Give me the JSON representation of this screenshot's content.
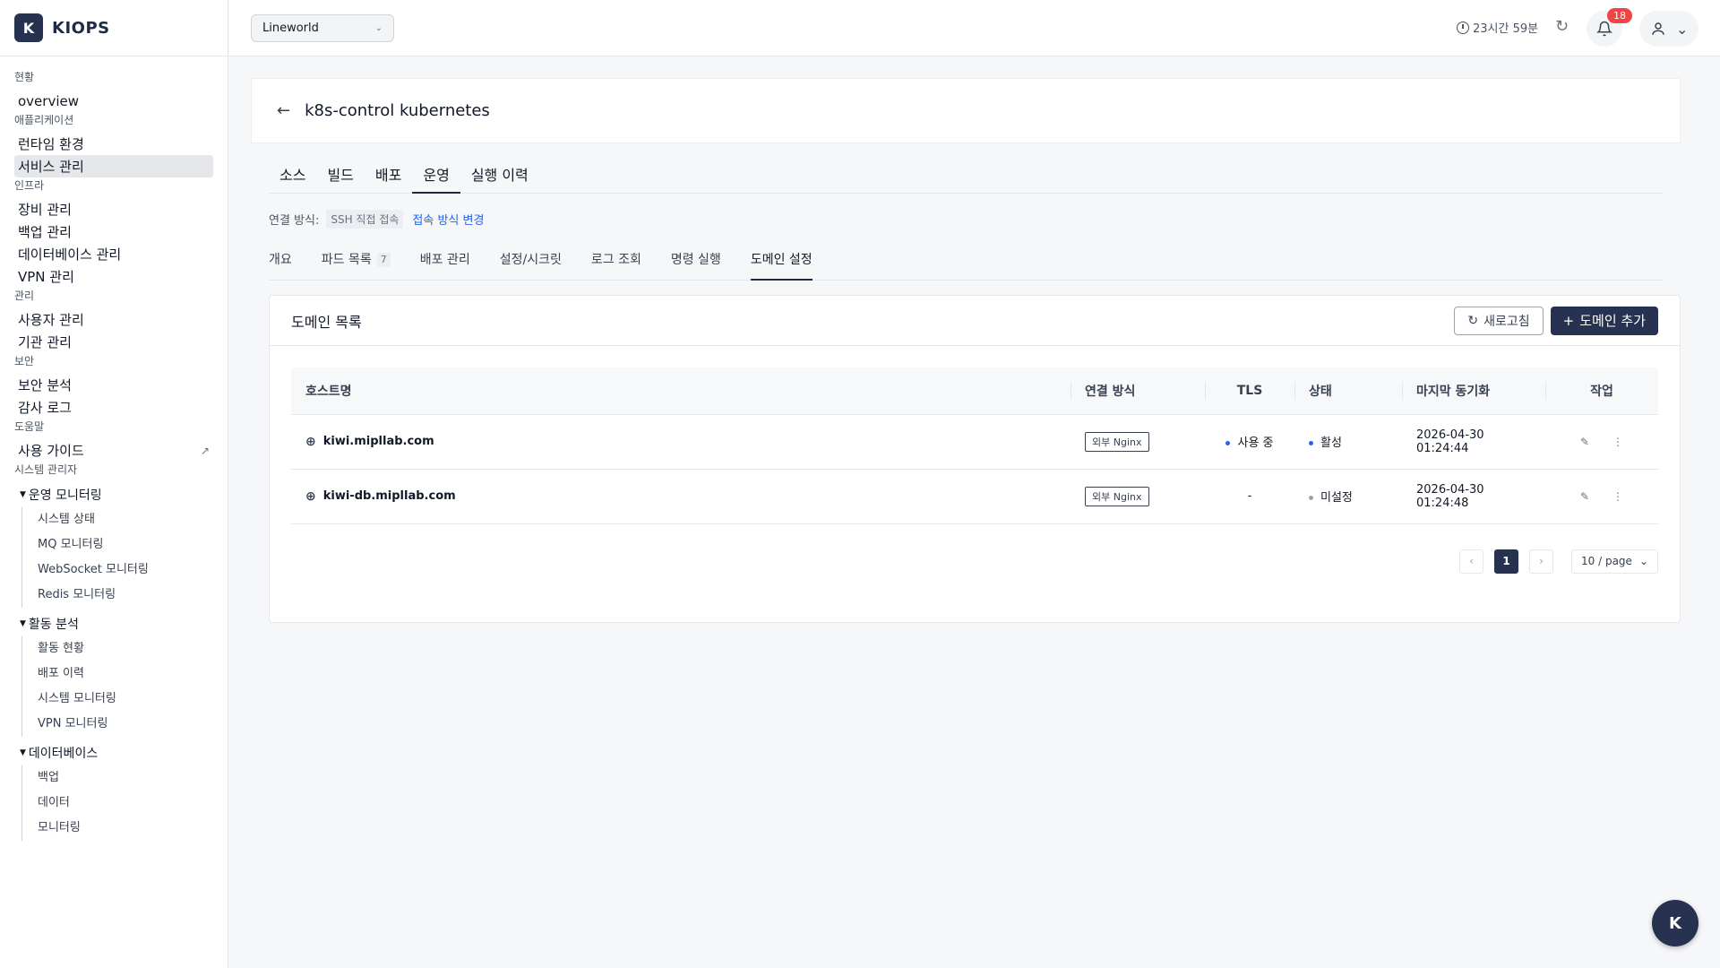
{
  "brand": {
    "logo_letter": "K",
    "name": "KIOPS"
  },
  "sidebar": {
    "groups": [
      {
        "title": "현황",
        "items": [
          {
            "label": "overview"
          }
        ]
      },
      {
        "title": "애플리케이션",
        "items": [
          {
            "label": "런타임 환경"
          },
          {
            "label": "서비스 관리",
            "active": true
          }
        ]
      },
      {
        "title": "인프라",
        "items": [
          {
            "label": "장비 관리"
          },
          {
            "label": "백업 관리"
          },
          {
            "label": "데이터베이스 관리"
          },
          {
            "label": "VPN 관리"
          }
        ]
      },
      {
        "title": "관리",
        "items": [
          {
            "label": "사용자 관리"
          },
          {
            "label": "기관 관리"
          }
        ]
      },
      {
        "title": "보안",
        "items": [
          {
            "label": "보안 분석"
          },
          {
            "label": "감사 로그"
          }
        ]
      },
      {
        "title": "도움말",
        "items": [
          {
            "label": "사용 가이드",
            "external_icon": "↗"
          }
        ]
      }
    ],
    "admin_title": "시스템 관리자",
    "tree": [
      {
        "label": "운영 모니터링",
        "children": [
          "시스템 상태",
          "MQ 모니터링",
          "WebSocket 모니터링",
          "Redis 모니터링"
        ]
      },
      {
        "label": "활동 분석",
        "children": [
          "활동 현황",
          "배포 이력",
          "시스템 모니터링",
          "VPN 모니터링"
        ]
      },
      {
        "label": "데이터베이스",
        "children": [
          "백업",
          "데이터",
          "모니터링"
        ]
      }
    ]
  },
  "topbar": {
    "workspace": "Lineworld",
    "session_time": "23시간 59분",
    "notification_count": "18"
  },
  "page": {
    "title": "k8s-control kubernetes",
    "tabs": [
      "소스",
      "빌드",
      "배포",
      "운영",
      "실행 이력"
    ],
    "active_tab": 3,
    "connection": {
      "label": "연결 방식:",
      "value": "SSH 직접 접속",
      "change_link": "접속 방식 변경"
    },
    "sub_tabs": [
      {
        "label": "개요"
      },
      {
        "label": "파드 목록",
        "count": "7"
      },
      {
        "label": "배포 관리"
      },
      {
        "label": "설정/시크릿"
      },
      {
        "label": "로그 조회"
      },
      {
        "label": "명령 실행"
      },
      {
        "label": "도메인 설정",
        "active": true
      }
    ]
  },
  "domain_card": {
    "title": "도메인 목록",
    "refresh_label": "새로고침",
    "add_label": "도메인 추가",
    "columns": [
      "호스트명",
      "연결 방식",
      "TLS",
      "상태",
      "마지막 동기화",
      "작업"
    ],
    "rows": [
      {
        "host": "kiwi.mipllab.com",
        "conn": "외부 Nginx",
        "tls": "사용 중",
        "tls_color": "#2563eb",
        "status": "활성",
        "status_color": "#2563eb",
        "synced": "2026-04-30 01:24:44"
      },
      {
        "host": "kiwi-db.mipllab.com",
        "conn": "외부 Nginx",
        "tls": "-",
        "tls_color": "",
        "status": "미설정",
        "status_color": "#9ca3af",
        "synced": "2026-04-30 01:24:48"
      }
    ],
    "pagination": {
      "current": "1",
      "page_size": "10 / page"
    }
  },
  "fab": {
    "letter": "K"
  },
  "icons": {
    "back": "arrow-left-icon",
    "globe": "globe-icon",
    "edit": "edit-icon",
    "more": "more-icon",
    "bell": "bell-icon",
    "user": "user-icon",
    "refresh": "refresh-icon",
    "clock": "clock-icon"
  }
}
